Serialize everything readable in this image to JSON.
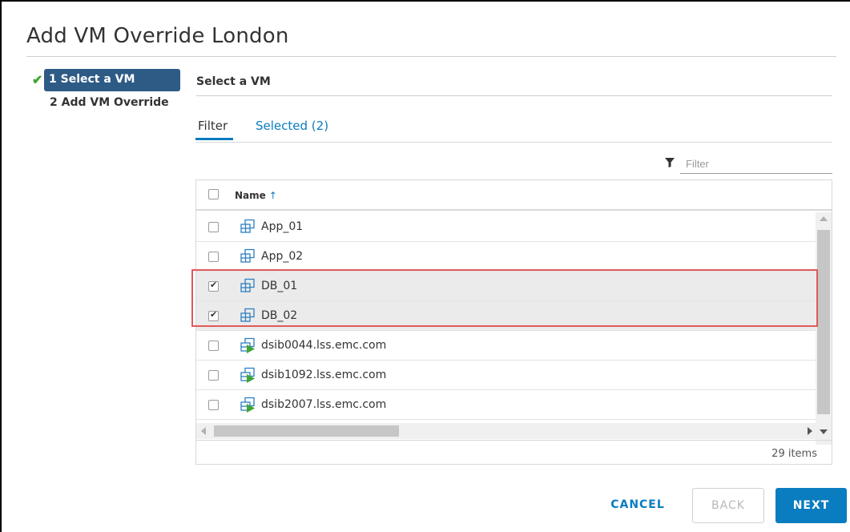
{
  "dialog": {
    "title": "Add VM Override London"
  },
  "wizard": {
    "steps": [
      {
        "label": "1 Select a VM",
        "state": "active-complete"
      },
      {
        "label": "2 Add VM Override",
        "state": "pending"
      }
    ]
  },
  "panel": {
    "title": "Select a VM",
    "tabs": [
      {
        "label": "Filter",
        "active": true
      },
      {
        "label": "Selected (2)",
        "active": false
      }
    ],
    "filter_placeholder": "Filter"
  },
  "grid": {
    "column_name": "Name",
    "sort_indicator": "↑",
    "rows": [
      {
        "name": "App_01",
        "checked": false,
        "icon": "vm-icon"
      },
      {
        "name": "App_02",
        "checked": false,
        "icon": "vm-icon"
      },
      {
        "name": "DB_01",
        "checked": true,
        "icon": "vm-icon"
      },
      {
        "name": "DB_02",
        "checked": true,
        "icon": "vm-icon"
      },
      {
        "name": "dsib0044.lss.emc.com",
        "checked": false,
        "icon": "vm-powered-on-icon"
      },
      {
        "name": "dsib1092.lss.emc.com",
        "checked": false,
        "icon": "vm-powered-on-icon"
      },
      {
        "name": "dsib2007.lss.emc.com",
        "checked": false,
        "icon": "vm-powered-on-icon"
      }
    ],
    "item_count": "29 items"
  },
  "buttons": {
    "cancel": "CANCEL",
    "back": "BACK",
    "next": "NEXT"
  },
  "colors": {
    "accent": "#0a7cc0",
    "step_active_bg": "#2e5b86",
    "check_green": "#3fa535",
    "highlight_red": "#e05a5a",
    "play_green": "#3fa535"
  }
}
